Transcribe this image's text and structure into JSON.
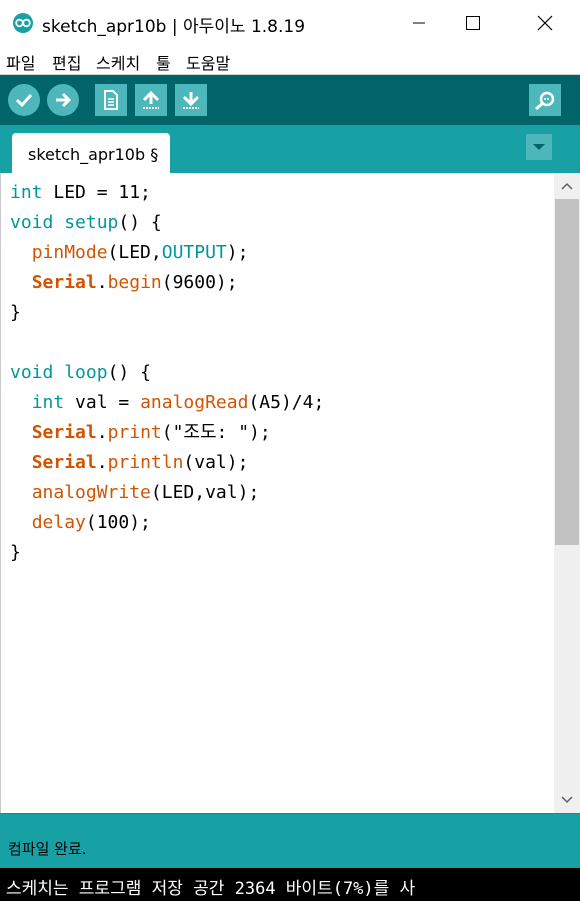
{
  "window": {
    "title": "sketch_apr10b | 아두이노 1.8.19"
  },
  "menu": {
    "items": [
      "파일",
      "편집",
      "스케치",
      "툴",
      "도움말"
    ]
  },
  "toolbar": {
    "buttons": [
      "verify-icon",
      "upload-icon",
      "new-icon",
      "open-icon",
      "save-icon",
      "serial-monitor-icon"
    ]
  },
  "tabs": [
    {
      "label": "sketch_apr10b §"
    }
  ],
  "editor": {
    "lines": [
      "int LED = 11;",
      "void setup() {",
      "  pinMode(LED,OUTPUT);",
      "  Serial.begin(9600);",
      "}",
      "",
      "void loop() {",
      "  int val = analogRead(A5)/4;",
      "  Serial.print(\"조도: \");",
      "  Serial.println(val);",
      "  analogWrite(LED,val);",
      "  delay(100);",
      "}"
    ]
  },
  "status": {
    "message": "컴파일 완료."
  },
  "console": {
    "message": "스케치는 프로그램 저장 공간 2364 바이트(7%)를 사"
  },
  "colors": {
    "toolbar": "#006468",
    "tabbar": "#17a1a5",
    "button": "#4db7bb",
    "keyword": "#00979c",
    "function": "#d35400",
    "console": "#000000"
  }
}
